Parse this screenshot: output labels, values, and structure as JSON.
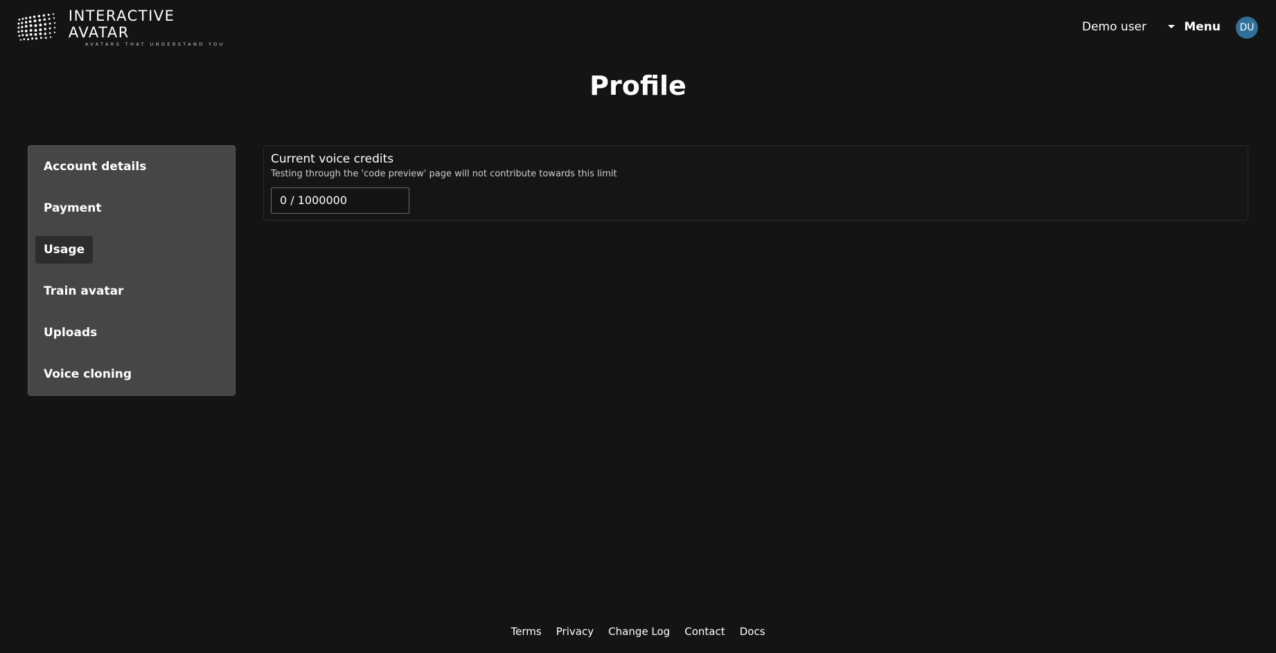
{
  "brand": {
    "name": "INTERACTIVE AVATAR",
    "tagline": "AVATARS THAT UNDERSTAND YOU",
    "icon": "wave-grid-logo"
  },
  "header": {
    "user_name": "Demo user",
    "menu_label": "Menu",
    "avatar_initials": "DU",
    "avatar_color": "#2f6f98"
  },
  "page": {
    "title": "Profile"
  },
  "sidebar": {
    "items": [
      {
        "label": "Account details",
        "active": false
      },
      {
        "label": "Payment",
        "active": false
      },
      {
        "label": "Usage",
        "active": true
      },
      {
        "label": "Train avatar",
        "active": false
      },
      {
        "label": "Uploads",
        "active": false
      },
      {
        "label": "Voice cloning",
        "active": false
      }
    ]
  },
  "usage": {
    "title": "Current voice credits",
    "subtitle": "Testing through the 'code preview' page will not contribute towards this limit",
    "credits_value": "0 / 1000000"
  },
  "footer": {
    "links": [
      "Terms",
      "Privacy",
      "Change Log",
      "Contact",
      "Docs"
    ]
  }
}
